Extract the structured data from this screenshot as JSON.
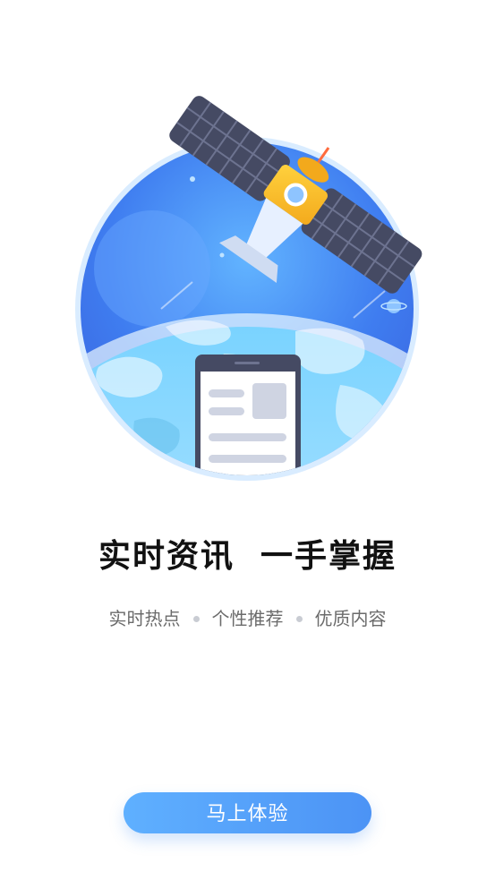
{
  "hero": {
    "illustration_icon": "satellite-earth-phone-illustration"
  },
  "headline": "实时资讯  一手掌握",
  "features": [
    "实时热点",
    "个性推荐",
    "优质内容"
  ],
  "cta_label": "马上体验",
  "colors": {
    "primary": "#4c93f5",
    "primary_light": "#5fb0ff",
    "headline": "#111111",
    "subtext": "#6b6b6b"
  }
}
